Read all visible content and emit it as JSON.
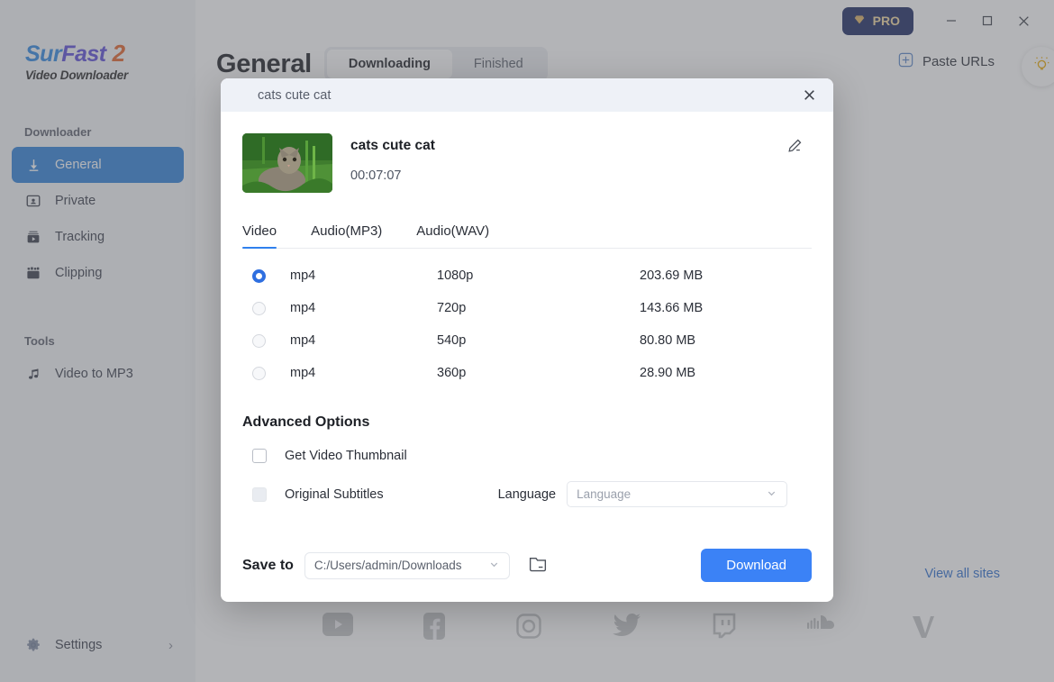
{
  "app": {
    "logo": {
      "part1": "Sur",
      "part2": "Fast",
      "part3": "2",
      "subtitle": "Video Downloader"
    },
    "accent_color": "#2f80d8",
    "download_color": "#3b82f6"
  },
  "sidebar": {
    "groups": [
      {
        "label": "Downloader",
        "items": [
          {
            "label": "General",
            "icon": "download-arrow-icon",
            "active": true
          },
          {
            "label": "Private",
            "icon": "private-user-icon",
            "active": false
          },
          {
            "label": "Tracking",
            "icon": "tracking-film-icon",
            "active": false
          },
          {
            "label": "Clipping",
            "icon": "clipping-scissors-icon",
            "active": false
          }
        ]
      },
      {
        "label": "Tools",
        "items": [
          {
            "label": "Video to MP3",
            "icon": "music-note-icon",
            "active": false
          }
        ]
      }
    ],
    "settings": {
      "label": "Settings",
      "icon": "gear-icon",
      "chevron": "chevron-right-icon"
    }
  },
  "titlebar": {
    "pro_label": "PRO",
    "pro_icon": "diamond-icon",
    "minimize": "minimize-icon",
    "maximize": "maximize-icon",
    "close": "close-icon"
  },
  "header": {
    "page_title": "General",
    "tabs": [
      {
        "label": "Downloading",
        "active": true
      },
      {
        "label": "Finished",
        "active": false
      }
    ],
    "paste_urls": {
      "label": "Paste URLs",
      "icon": "plus-square-icon"
    },
    "tip_button_icon": "lightbulb-icon"
  },
  "background": {
    "view_all_sites": "View all sites",
    "social_sites": [
      "youtube-icon",
      "facebook-icon",
      "instagram-icon",
      "twitter-icon",
      "twitch-icon",
      "soundcloud-icon",
      "vimeo-icon"
    ]
  },
  "modal": {
    "header_title": "cats cute cat",
    "close_icon": "close-icon",
    "video": {
      "title": "cats cute cat",
      "duration": "00:07:07",
      "thumbnail_alt": "tabby cat sitting in green grass",
      "edit_icon": "edit-pencil-icon"
    },
    "format_tabs": [
      {
        "label": "Video",
        "active": true
      },
      {
        "label": "Audio(MP3)",
        "active": false
      },
      {
        "label": "Audio(WAV)",
        "active": false
      }
    ],
    "format_rows": [
      {
        "format": "mp4",
        "resolution": "1080p",
        "size": "203.69 MB",
        "selected": true
      },
      {
        "format": "mp4",
        "resolution": "720p",
        "size": "143.66 MB",
        "selected": false
      },
      {
        "format": "mp4",
        "resolution": "540p",
        "size": "80.80 MB",
        "selected": false
      },
      {
        "format": "mp4",
        "resolution": "360p",
        "size": "28.90 MB",
        "selected": false
      }
    ],
    "advanced": {
      "title": "Advanced Options",
      "thumbnail_option": {
        "label": "Get Video Thumbnail",
        "checked": false,
        "disabled": false
      },
      "subtitles_option": {
        "label": "Original Subtitles",
        "checked": false,
        "disabled": true
      },
      "language_label": "Language",
      "language_value": "Language",
      "language_placeholder": "Language"
    },
    "footer": {
      "save_to_label": "Save to",
      "save_path": "C:/Users/admin/Downloads",
      "folder_icon": "folder-icon",
      "download_label": "Download"
    }
  }
}
